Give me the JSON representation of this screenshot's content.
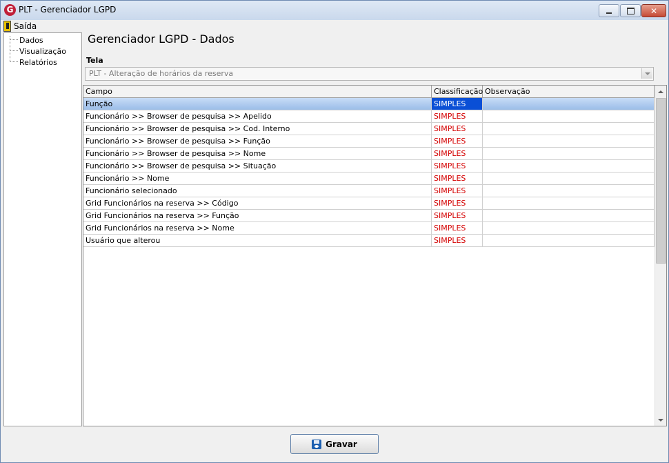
{
  "window": {
    "title": "PLT - Gerenciador LGPD",
    "app_icon_letter": "G"
  },
  "menu": {
    "exit_label": "Saída"
  },
  "tree": {
    "items": [
      "Dados",
      "Visualização",
      "Relatórios"
    ]
  },
  "page": {
    "title": "Gerenciador LGPD - Dados",
    "tela_label": "Tela",
    "tela_value": "PLT - Alteração de horários da reserva"
  },
  "grid": {
    "columns": [
      "Campo",
      "Classificação",
      "Observação"
    ],
    "rows": [
      {
        "campo": "Função",
        "classificacao": "SIMPLES",
        "observacao": ""
      },
      {
        "campo": "Funcionário >> Browser de pesquisa >> Apelido",
        "classificacao": "SIMPLES",
        "observacao": ""
      },
      {
        "campo": "Funcionário >> Browser de pesquisa >> Cod. Interno",
        "classificacao": "SIMPLES",
        "observacao": ""
      },
      {
        "campo": "Funcionário >> Browser de pesquisa >> Função",
        "classificacao": "SIMPLES",
        "observacao": ""
      },
      {
        "campo": "Funcionário >> Browser de pesquisa >> Nome",
        "classificacao": "SIMPLES",
        "observacao": ""
      },
      {
        "campo": "Funcionário >> Browser de pesquisa >> Situação",
        "classificacao": "SIMPLES",
        "observacao": ""
      },
      {
        "campo": "Funcionário >> Nome",
        "classificacao": "SIMPLES",
        "observacao": ""
      },
      {
        "campo": "Funcionário selecionado",
        "classificacao": "SIMPLES",
        "observacao": ""
      },
      {
        "campo": "Grid Funcionários na reserva >> Código",
        "classificacao": "SIMPLES",
        "observacao": ""
      },
      {
        "campo": "Grid Funcionários na reserva >> Função",
        "classificacao": "SIMPLES",
        "observacao": ""
      },
      {
        "campo": "Grid Funcionários na reserva >> Nome",
        "classificacao": "SIMPLES",
        "observacao": ""
      },
      {
        "campo": "Usuário que alterou",
        "classificacao": "SIMPLES",
        "observacao": ""
      }
    ],
    "selected_row": 0
  },
  "footer": {
    "save_label": "Gravar"
  },
  "colors": {
    "classification_text": "#d40000",
    "selection": "#0a4fd6"
  }
}
